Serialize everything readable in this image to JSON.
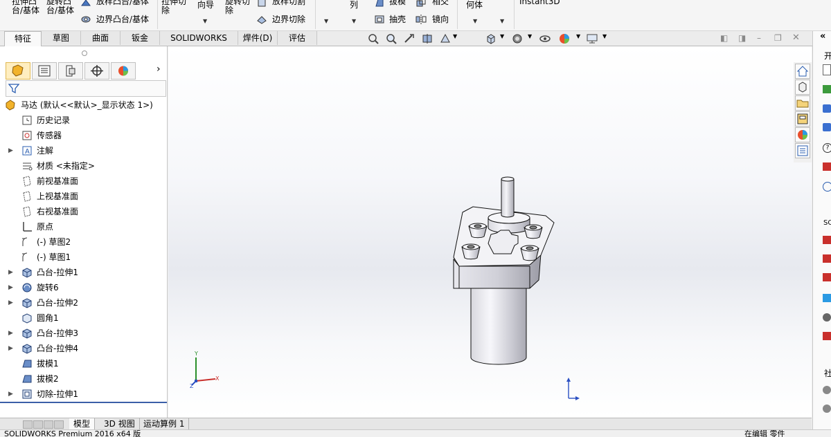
{
  "ribbon": {
    "extrude_boss": "拉伸凸\n台/基体",
    "revolve_boss": "旋转凸\n台/基体",
    "loft_boss": "放样凸台/基体",
    "boundary_boss": "边界凸台/基体",
    "extrude_cut": "拉伸切\n除",
    "hole_wizard": "向导",
    "revolve_cut": "旋转切\n除",
    "loft_cut": "放样切割",
    "boundary_cut": "边界切除",
    "pattern": "列",
    "draft": "拔模",
    "intersect": "相交",
    "shell": "抽壳",
    "mirror": "镜向",
    "ref_geometry": "何体",
    "instant3d": "Instant3D"
  },
  "command_tabs": [
    "特征",
    "草图",
    "曲面",
    "钣金",
    "SOLIDWORKS MBD",
    "焊件(D)",
    "评估"
  ],
  "active_command_tab": "特征",
  "tree": {
    "root": "马达  (默认<<默认>_显示状态 1>)",
    "items": [
      {
        "label": "历史记录",
        "icon": "history-icon",
        "expandable": false
      },
      {
        "label": "传感器",
        "icon": "sensor-icon",
        "expandable": false
      },
      {
        "label": "注解",
        "icon": "annotation-icon",
        "expandable": true
      },
      {
        "label": "材质 <未指定>",
        "icon": "material-icon",
        "expandable": false
      },
      {
        "label": "前视基准面",
        "icon": "plane-icon",
        "expandable": false
      },
      {
        "label": "上视基准面",
        "icon": "plane-icon",
        "expandable": false
      },
      {
        "label": "右视基准面",
        "icon": "plane-icon",
        "expandable": false
      },
      {
        "label": "原点",
        "icon": "origin-icon",
        "expandable": false
      },
      {
        "label": "(-) 草图2",
        "icon": "sketch-icon",
        "expandable": false
      },
      {
        "label": "(-) 草图1",
        "icon": "sketch-icon",
        "expandable": false
      },
      {
        "label": "凸台-拉伸1",
        "icon": "extrude-icon",
        "expandable": true
      },
      {
        "label": "旋转6",
        "icon": "revolve-icon",
        "expandable": true
      },
      {
        "label": "凸台-拉伸2",
        "icon": "extrude-icon",
        "expandable": true
      },
      {
        "label": "圆角1",
        "icon": "fillet-icon",
        "expandable": false
      },
      {
        "label": "凸台-拉伸3",
        "icon": "extrude-icon",
        "expandable": true
      },
      {
        "label": "凸台-拉伸4",
        "icon": "extrude-icon",
        "expandable": true
      },
      {
        "label": "拔模1",
        "icon": "draft-icon",
        "expandable": false
      },
      {
        "label": "拔模2",
        "icon": "draft-icon",
        "expandable": false
      },
      {
        "label": "切除-拉伸1",
        "icon": "cut-extrude-icon",
        "expandable": true
      }
    ]
  },
  "bottom_tabs": [
    "模型",
    "3D 视图",
    "运动算例 1"
  ],
  "active_bottom_tab": "模型",
  "status": {
    "left": "SOLIDWORKS Premium 2016 x64 版",
    "right": "在编辑 零件"
  },
  "taskpane": {
    "label1": "开",
    "label2": "SO",
    "label3": "社"
  },
  "triad": {
    "x": "X",
    "y": "Y",
    "z": "Z"
  },
  "colors": {
    "accent": "#3b5fa8",
    "feature_tree_bg": "#ffffff"
  }
}
